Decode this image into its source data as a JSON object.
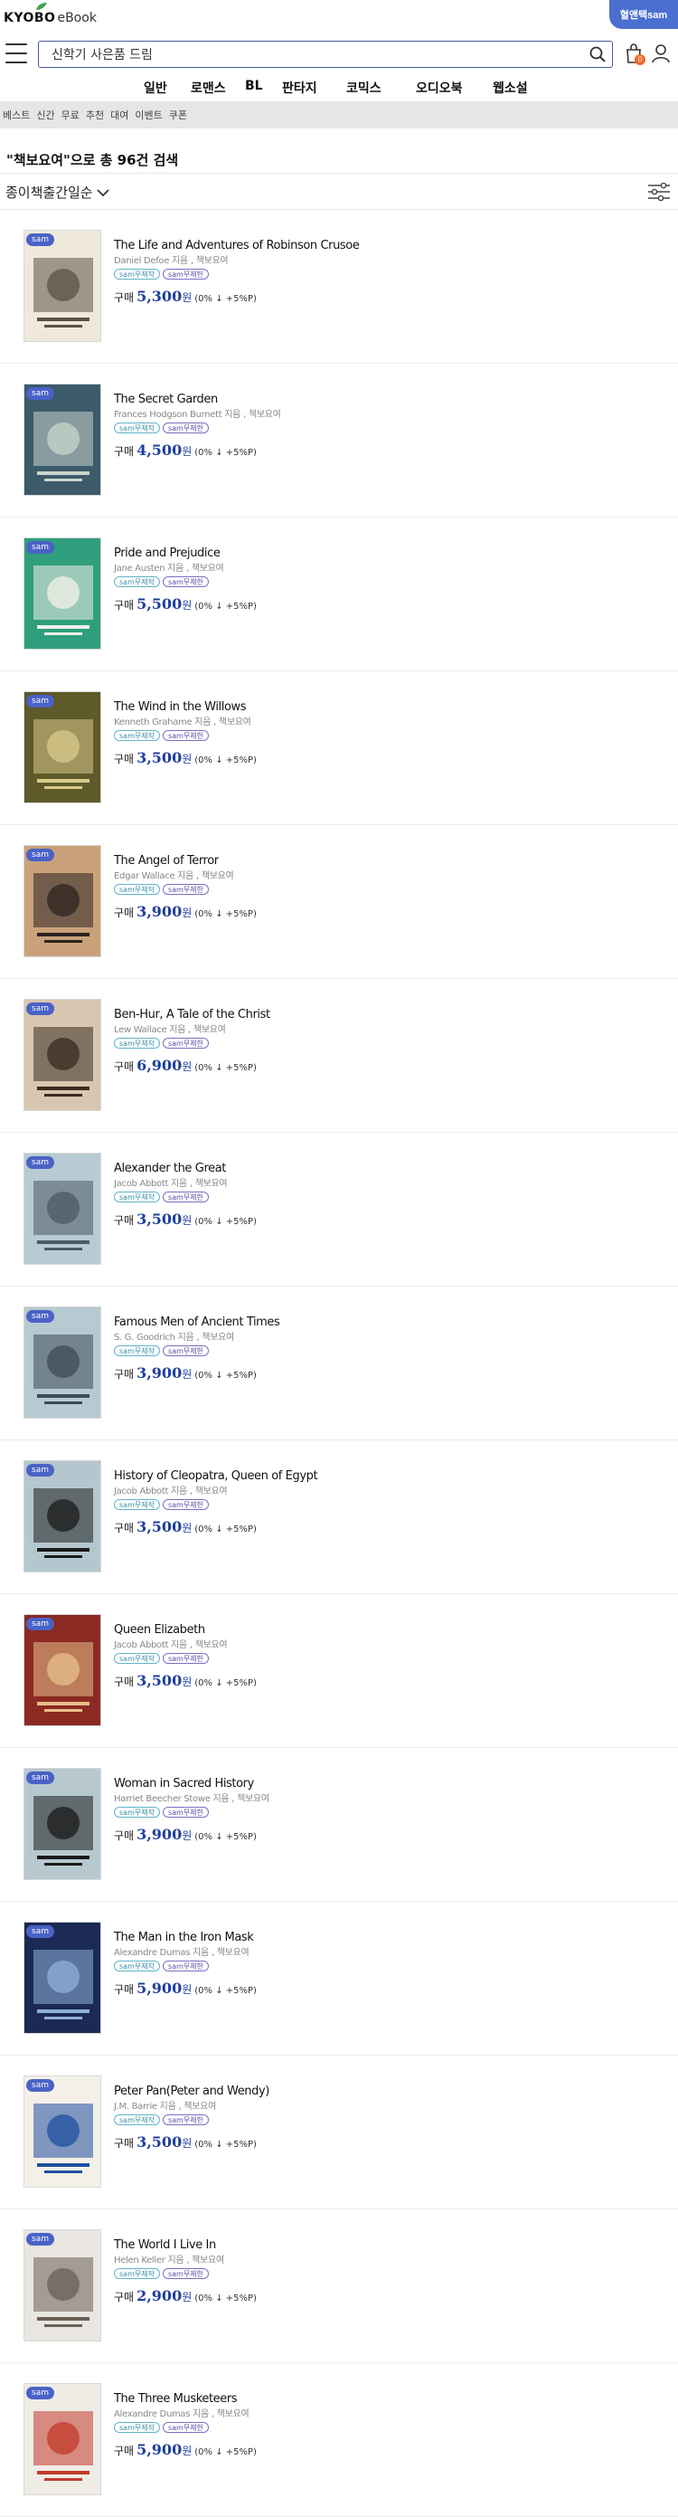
{
  "header": {
    "brand": "KYOBO",
    "brand_suffix": "eBook",
    "promo": "혈앤택sam",
    "search_value": "신학기 사은품 드림",
    "cart_count": "0"
  },
  "categories": [
    "일반",
    "로맨스",
    "BL",
    "판타지",
    "코믹스",
    "오디오북",
    "웹소설"
  ],
  "subnav": [
    "베스트",
    "신간",
    "무료",
    "추천",
    "대여",
    "이벤트",
    "쿠폰"
  ],
  "result_title": "\"책보요여\"으로 총 96건 검색",
  "sort_label": "종이책출간일순",
  "common": {
    "sam_tag": "sam",
    "badge1": "sam무제작",
    "badge2": "sam무제한",
    "price_label": "구매",
    "price_unit": "원",
    "price_extra": "(0% ↓ +5%P)",
    "author_suffix": "지음",
    "publisher": "책보요여"
  },
  "books": [
    {
      "title": "The Life and Adventures of Robinson Crusoe",
      "author": "Daniel Defoe",
      "price": "5,300",
      "cover_bg": "#efe9dc",
      "cover_accent": "#5b5246"
    },
    {
      "title": "The Secret Garden",
      "author": "Frances Hodgson Burnett",
      "price": "4,500",
      "cover_bg": "#3c5a6a",
      "cover_accent": "#c9d6cc"
    },
    {
      "title": "Pride and Prejudice",
      "author": "Jane Austen",
      "price": "5,500",
      "cover_bg": "#2f9e7c",
      "cover_accent": "#f4f1ea"
    },
    {
      "title": "The Wind in the Willows",
      "author": "Kenneth Grahame",
      "price": "3,500",
      "cover_bg": "#5e5a2a",
      "cover_accent": "#d9c98a"
    },
    {
      "title": "The Angel of Terror",
      "author": "Edgar Wallace",
      "price": "3,900",
      "cover_bg": "#c9a27a",
      "cover_accent": "#2b2320"
    },
    {
      "title": "Ben-Hur, A Tale of the Christ",
      "author": "Lew Wallace",
      "price": "6,900",
      "cover_bg": "#d8c7b0",
      "cover_accent": "#3a2a20"
    },
    {
      "title": "Alexander the Great",
      "author": "Jacob Abbott",
      "price": "3,500",
      "cover_bg": "#b8cbd2",
      "cover_accent": "#4a5a66"
    },
    {
      "title": "Famous Men of Ancient Times",
      "author": "S. G. Goodrich",
      "price": "3,900",
      "cover_bg": "#b6cad1",
      "cover_accent": "#3d4b55"
    },
    {
      "title": "History of Cleopatra, Queen of Egypt",
      "author": "Jacob Abbott",
      "price": "3,500",
      "cover_bg": "#b4c7ce",
      "cover_accent": "#1b1b1b"
    },
    {
      "title": "Queen Elizabeth",
      "author": "Jacob Abbott",
      "price": "3,500",
      "cover_bg": "#8a2a22",
      "cover_accent": "#e8c08a"
    },
    {
      "title": "Woman in Sacred History",
      "author": "Harriet Beecher Stowe",
      "price": "3,900",
      "cover_bg": "#b7c9cf",
      "cover_accent": "#1a1a1a"
    },
    {
      "title": "The Man in the Iron Mask",
      "author": "Alexandre Dumas",
      "price": "5,900",
      "cover_bg": "#1b2a55",
      "cover_accent": "#8fb0d9"
    },
    {
      "title": "Peter Pan(Peter and Wendy)",
      "author": "J.M. Barrie",
      "price": "3,500",
      "cover_bg": "#f4f0e8",
      "cover_accent": "#1f4f9e"
    },
    {
      "title": "The World I Live In",
      "author": "Helen Keller",
      "price": "2,900",
      "cover_bg": "#e9e6e1",
      "cover_accent": "#6b5f55"
    },
    {
      "title": "The Three Musketeers",
      "author": "Alexandre Dumas",
      "price": "5,900",
      "cover_bg": "#efece6",
      "cover_accent": "#c23a2a"
    }
  ]
}
